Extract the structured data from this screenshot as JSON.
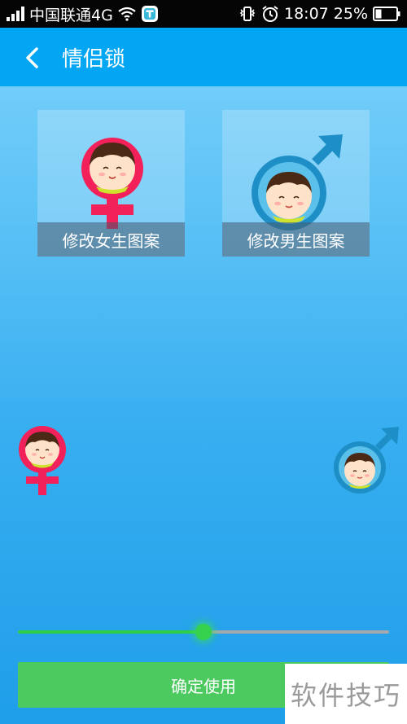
{
  "status_bar": {
    "carrier": "中国联通4G",
    "time": "18:07",
    "battery": "25%"
  },
  "app_bar": {
    "title": "情侣锁"
  },
  "cards": {
    "female_label": "修改女生图案",
    "male_label": "修改男生图案"
  },
  "slider": {
    "value_fraction": 0.5
  },
  "confirm_button": {
    "label": "确定使用"
  },
  "watermark": {
    "text": "软件技巧"
  },
  "colors": {
    "app_bar": "#03a6f3",
    "female_symbol": "#f2215a",
    "male_symbol": "#1e8fc6",
    "confirm": "#4cc95f",
    "slider_active": "#2fce4a"
  },
  "icons": [
    "signal-icon",
    "wifi-icon",
    "notification-t-icon",
    "vibrate-icon",
    "alarm-icon",
    "battery-icon",
    "back-arrow-icon",
    "female-symbol-icon",
    "male-symbol-icon"
  ]
}
